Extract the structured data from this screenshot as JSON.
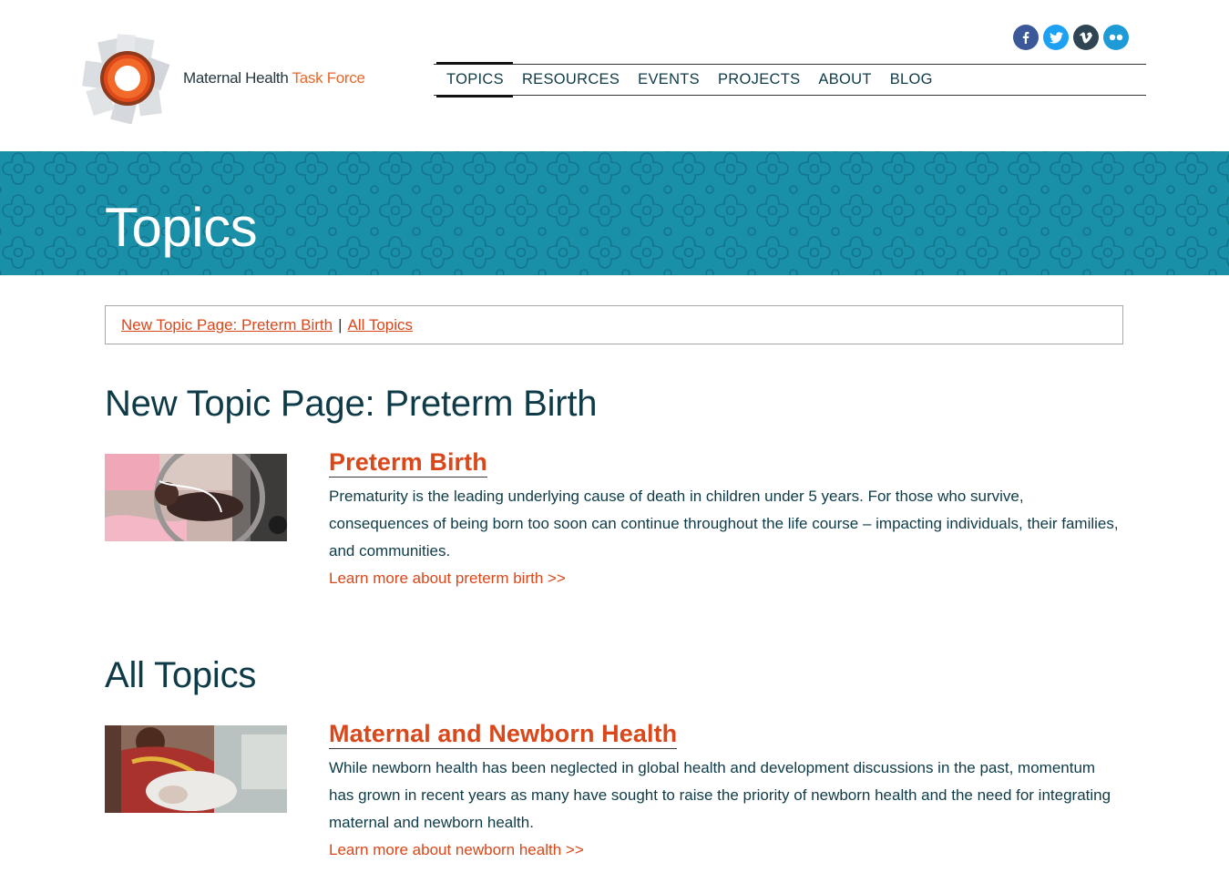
{
  "header": {
    "logo_text_primary": "Maternal Health",
    "logo_text_accent": "Task Force",
    "social": [
      {
        "icon": "facebook-icon",
        "glyph": "f"
      },
      {
        "icon": "twitter-icon",
        "glyph": "t"
      },
      {
        "icon": "vimeo-icon",
        "glyph": "v"
      },
      {
        "icon": "flickr-icon",
        "glyph": "••"
      }
    ],
    "nav": [
      "TOPICS",
      "RESOURCES",
      "EVENTS",
      "PROJECTS",
      "ABOUT",
      "BLOG"
    ],
    "active_nav": "TOPICS"
  },
  "banner": {
    "title": "Topics",
    "color": "#1a8fa8"
  },
  "breadcrumb": {
    "link1": "New Topic Page: Preterm Birth",
    "separator": "|",
    "link2": "All Topics"
  },
  "sections": [
    {
      "heading": "New Topic Page: Preterm Birth",
      "card": {
        "title": "Preterm Birth",
        "description": "Prematurity is the leading underlying cause of death in children under 5 years. For those who survive, consequences of being born too soon can continue throughout the life course – impacting individuals, their families, and communities.",
        "link": "Learn more about preterm birth >>"
      }
    },
    {
      "heading": "All Topics",
      "card": {
        "title": "Maternal and Newborn Health",
        "description": "While newborn health has been neglected in global health and development discussions in the past, momentum has grown in recent years as many have sought to raise the priority of newborn health and the need for integrating maternal and newborn health.",
        "link": "Learn more about newborn health >>"
      }
    }
  ],
  "colors": {
    "accent": "#d9471a",
    "text": "#0e3b47",
    "banner": "#1a8fa8"
  }
}
